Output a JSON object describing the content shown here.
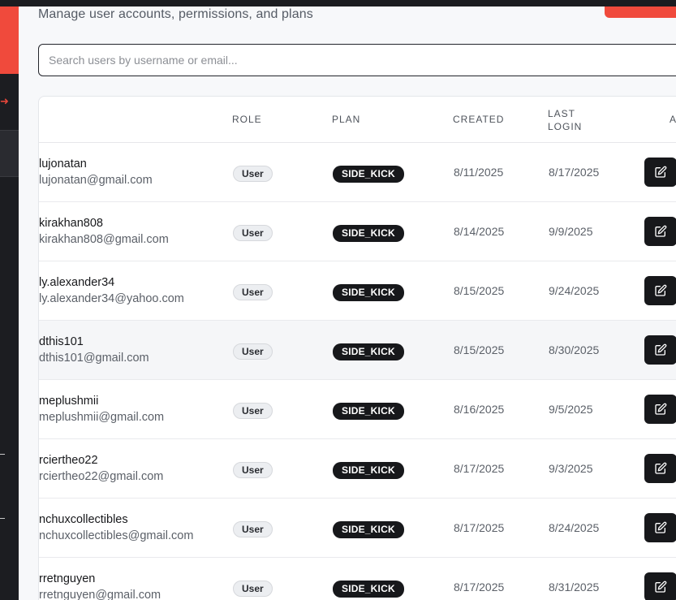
{
  "colors": {
    "brand": "#f04a3c",
    "sidebar": "#1c1d21",
    "badge_dark": "#17181b"
  },
  "header": {
    "subtitle": "Manage user accounts, permissions, and plans"
  },
  "search": {
    "placeholder": "Search users by username or email...",
    "value": ""
  },
  "table": {
    "columns": {
      "role": "ROLE",
      "plan": "PLAN",
      "created": "CREATED",
      "last_login_1": "LAST",
      "last_login_2": "LOGIN",
      "actions": "A"
    },
    "rows": [
      {
        "username": "lujonatan",
        "email": "lujonatan@gmail.com",
        "role": "User",
        "plan": "SIDE_KICK",
        "created": "8/11/2025",
        "last_login": "8/17/2025"
      },
      {
        "username": "kirakhan808",
        "email": "kirakhan808@gmail.com",
        "role": "User",
        "plan": "SIDE_KICK",
        "created": "8/14/2025",
        "last_login": "9/9/2025"
      },
      {
        "username": "ly.alexander34",
        "email": "ly.alexander34@yahoo.com",
        "role": "User",
        "plan": "SIDE_KICK",
        "created": "8/15/2025",
        "last_login": "9/24/2025"
      },
      {
        "username": "dthis101",
        "email": "dthis101@gmail.com",
        "role": "User",
        "plan": "SIDE_KICK",
        "created": "8/15/2025",
        "last_login": "8/30/2025"
      },
      {
        "username": "meplushmii",
        "email": "meplushmii@gmail.com",
        "role": "User",
        "plan": "SIDE_KICK",
        "created": "8/16/2025",
        "last_login": "9/5/2025"
      },
      {
        "username": "rciertheo22",
        "email": "rciertheo22@gmail.com",
        "role": "User",
        "plan": "SIDE_KICK",
        "created": "8/17/2025",
        "last_login": "9/3/2025"
      },
      {
        "username": "nchuxcollectibles",
        "email": "nchuxcollectibles@gmail.com",
        "role": "User",
        "plan": "SIDE_KICK",
        "created": "8/17/2025",
        "last_login": "8/24/2025"
      },
      {
        "username": "rretnguyen",
        "email": "rretnguyen@gmail.com",
        "role": "User",
        "plan": "SIDE_KICK",
        "created": "8/17/2025",
        "last_login": "8/31/2025"
      }
    ]
  },
  "icons": {
    "edit": "edit-icon",
    "nav": "arrow-right-icon"
  }
}
